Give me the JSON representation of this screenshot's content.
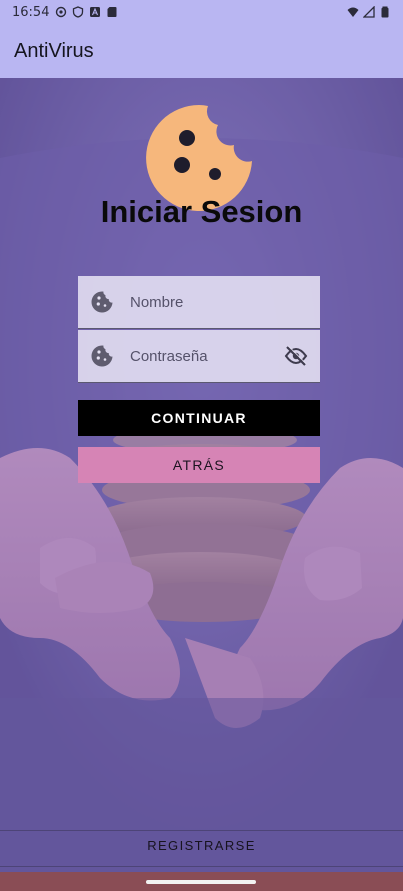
{
  "status_bar": {
    "time": "16:54",
    "left_icons": [
      "sync-icon",
      "shield-icon",
      "a-icon",
      "sd-card-icon"
    ],
    "right_icons": [
      "wifi-icon",
      "signal-icon",
      "battery-icon"
    ]
  },
  "app_bar": {
    "title": "AntiVirus"
  },
  "login": {
    "logo_icon": "cookie-icon",
    "title": "Iniciar Sesion",
    "name_placeholder": "Nombre",
    "password_placeholder": "Contraseña",
    "field_icon": "cookie-icon",
    "password_toggle_icon": "visibility-off-icon",
    "continue_label": "CONTINUAR",
    "back_label": "ATRÁS",
    "register_label": "REGISTRARSE"
  },
  "colors": {
    "app_bar": "#b9b6f2",
    "cookie": "#f6b77c",
    "continue_button": "#000000",
    "back_button": "#d684b5",
    "nav_bar": "#8a4d55"
  }
}
